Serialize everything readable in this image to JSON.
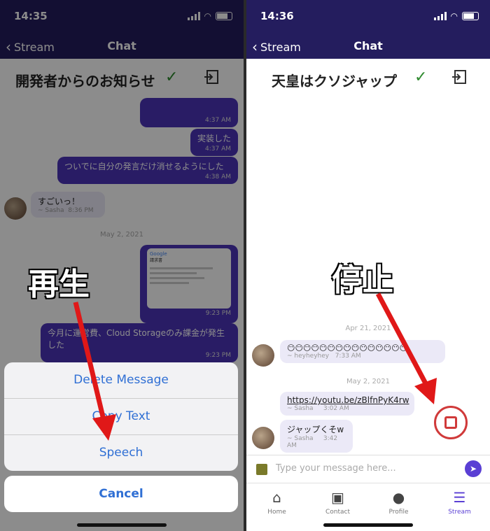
{
  "left": {
    "time": "14:35",
    "nav_back": "Stream",
    "nav_title": "Chat",
    "chat_name": "開発者からのお知らせ",
    "messages": [
      {
        "text": "",
        "time": "4:37 AM"
      },
      {
        "text": "実装した",
        "time": "4:37 AM"
      },
      {
        "text": "ついでに自分の発言だけ消せるようにした",
        "time": "4:38 AM"
      }
    ],
    "incoming": {
      "text": "すごいっ！",
      "sender": "~ Sasha",
      "time": "8:36 PM"
    },
    "date_sep": "May 2, 2021",
    "image_time": "9:23 PM",
    "image_text": {
      "brand": "Google",
      "title": "請求書"
    },
    "msg_last": {
      "text": "今月に運営費、Cloud Storageのみ課金が発生した",
      "time": "9:23 PM"
    },
    "overlay_label": "再生",
    "sheet_items": [
      "Delete Message",
      "Copy Text",
      "Speech"
    ],
    "cancel": "Cancel"
  },
  "right": {
    "time": "14:36",
    "nav_back": "Stream",
    "nav_title": "Chat",
    "chat_name": "天皇はクソジャップ",
    "overlay_label": "停止",
    "date1": "Apr 21, 2021",
    "msg1": {
      "text": "😶😶😶😶😶😶😶😶😶😶😶😶😶😶😶",
      "sender": "~ heyheyhey",
      "time": "7:33 AM"
    },
    "date2": "May 2, 2021",
    "msg2": {
      "text": "https://youtu.be/zBlfnPyK4rw",
      "sender": "~ Sasha",
      "time": "3:02 AM"
    },
    "msg3": {
      "text": "ジャップくそw",
      "sender": "~ Sasha",
      "time": "3:42 AM"
    },
    "input_placeholder": "Type your message here...",
    "tabs": [
      {
        "label": "Home",
        "icon": "home-icon"
      },
      {
        "label": "Contact",
        "icon": "contact-icon"
      },
      {
        "label": "Profile",
        "icon": "profile-icon"
      },
      {
        "label": "Stream",
        "icon": "stream-icon"
      }
    ]
  },
  "colors": {
    "header": "#241d5e",
    "bubble": "#4b34b8",
    "accent": "#2f6fd4",
    "arrow": "#e01818"
  }
}
